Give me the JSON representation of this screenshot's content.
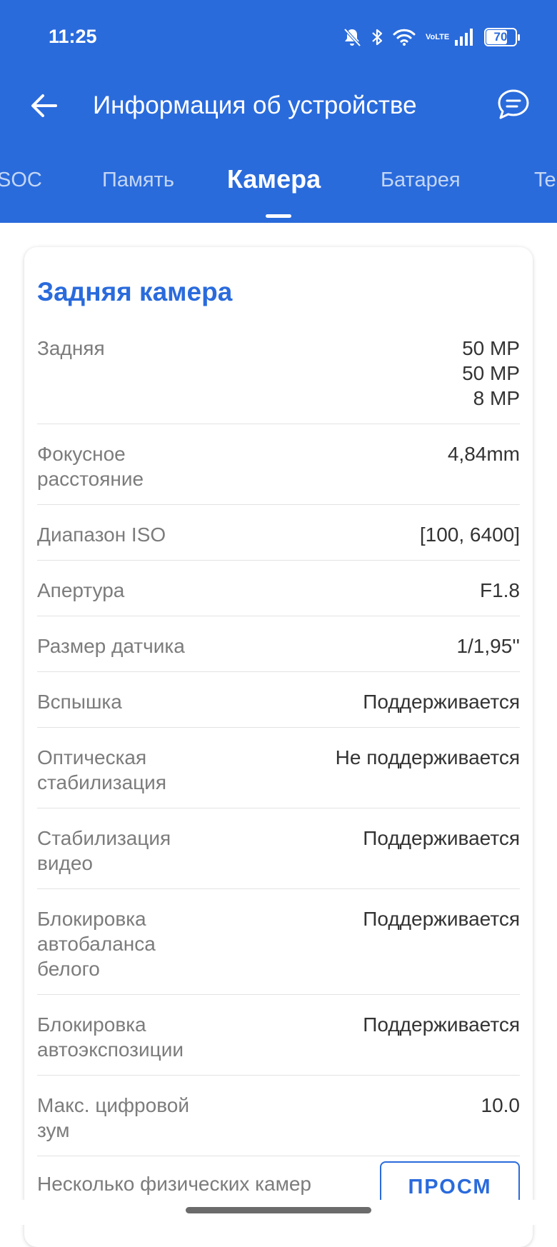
{
  "status_bar": {
    "time": "11:25",
    "volte_top": "Vo",
    "volte_bottom": "LTE",
    "battery": "70"
  },
  "app_bar": {
    "title": "Информация об устройстве"
  },
  "tabs": [
    {
      "label": "SOC"
    },
    {
      "label": "Память"
    },
    {
      "label": "Камера",
      "active": true
    },
    {
      "label": "Батарея"
    },
    {
      "label": "Te"
    }
  ],
  "card": {
    "title": "Задняя камера",
    "rows": [
      {
        "label": "Задняя",
        "value": "50 MP\n50 MP\n8 MP"
      },
      {
        "label": "Фокусное расстояние",
        "value": "4,84mm"
      },
      {
        "label": "Диапазон ISO",
        "value": "[100, 6400]"
      },
      {
        "label": "Апертура",
        "value": "F1.8"
      },
      {
        "label": "Размер датчика",
        "value": "1/1,95''"
      },
      {
        "label": "Вспышка",
        "value": "Поддерживается"
      },
      {
        "label": "Оптическая стабилизация",
        "value": "Не поддерживается"
      },
      {
        "label": "Стабилизация видео",
        "value": "Поддерживается"
      },
      {
        "label": "Блокировка автобаланса белого",
        "value": "Поддерживается"
      },
      {
        "label": "Блокировка автоэкспозиции",
        "value": "Поддерживается"
      },
      {
        "label": "Макс. цифровой зум",
        "value": "10.0"
      }
    ],
    "multi_camera_label": "Несколько физических камер",
    "view_button": "ПРОСМ"
  },
  "colors": {
    "primary": "#2a6bdc",
    "label_gray": "#7c7c7c",
    "value_dark": "#333333"
  }
}
